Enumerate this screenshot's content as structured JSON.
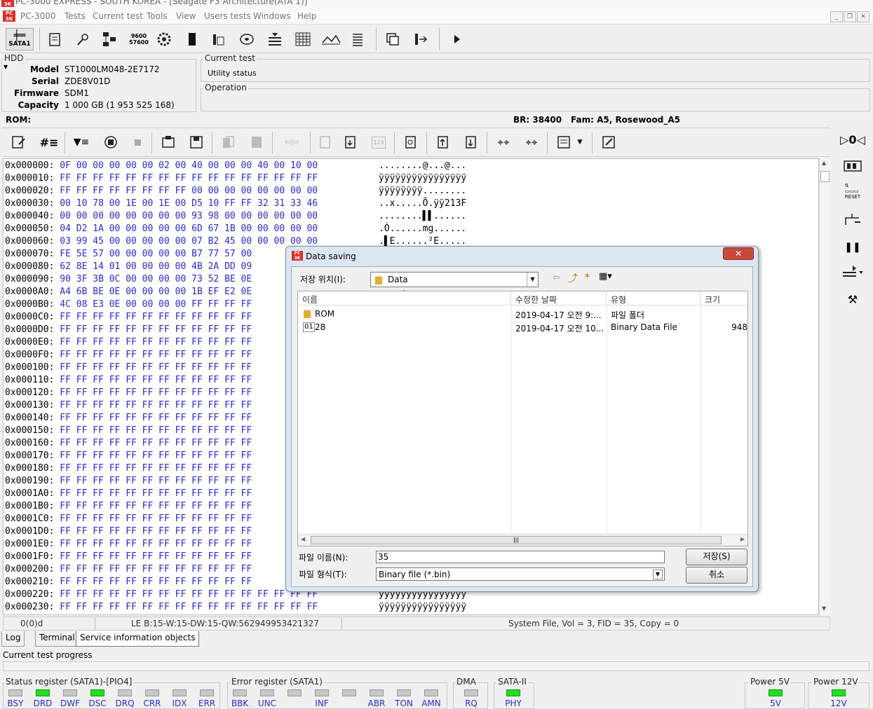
{
  "app": {
    "title": "PC-3000 EXPRESS - SOUTH KOREA - [Seagate F3 Architecture(ATA 1)]",
    "menu": [
      "PC-3000",
      "Tests",
      "Current test",
      "Tools",
      "View",
      "Users tests",
      "Windows",
      "Help"
    ],
    "sata_label": "SATA1"
  },
  "hdd": {
    "group_label": "HDD",
    "fields": [
      {
        "k": "Model",
        "v": "ST1000LM048-2E7172"
      },
      {
        "k": "Serial",
        "v": "ZDE8V01D"
      },
      {
        "k": "Firmware",
        "v": "SDM1"
      },
      {
        "k": "Capacity",
        "v": "1 000 GB (1 953 525 168)"
      }
    ]
  },
  "current_test": {
    "label": "Current test",
    "value": "Utility status"
  },
  "operation": {
    "label": "Operation"
  },
  "rom_bar": {
    "rom": "ROM:",
    "br": "BR: 38400",
    "fam": "Fam: A5, Rosewood_A5"
  },
  "hex": {
    "rows": [
      {
        "off": "0x000000:",
        "bytes": "0F 00 00 00 00 00 02 00 40 00 00 00 40 00 10 00",
        "ascii": "........@...@..."
      },
      {
        "off": "0x000010:",
        "bytes": "FF FF FF FF FF FF FF FF FF FF FF FF FF FF FF FF",
        "ascii": "ÿÿÿÿÿÿÿÿÿÿÿÿÿÿÿÿ"
      },
      {
        "off": "0x000020:",
        "bytes": "FF FF FF FF FF FF FF FF 00 00 00 00 00 00 00 00",
        "ascii": "ÿÿÿÿÿÿÿÿ........"
      },
      {
        "off": "0x000030:",
        "bytes": "00 10 78 00 1E 00 1E 00 D5 10 FF FF 32 31 33 46",
        "ascii": "..x.....Õ.ÿÿ213F"
      },
      {
        "off": "0x000040:",
        "bytes": "00 00 00 00 00 00 00 00 93 98 00 00 00 00 00 00",
        "ascii": "........▌▌......"
      },
      {
        "off": "0x000050:",
        "bytes": "04 D2 1A 00 00 00 00 00 6D 67 1B 00 00 00 00 00",
        "ascii": ".Ò......mg......"
      },
      {
        "off": "0x000060:",
        "bytes": "03 99 45 00 00 00 00 00 07 B2 45 00 00 00 00 00",
        "ascii": ".▌E......²E....."
      },
      {
        "off": "0x000070:",
        "bytes": "FE 5E 57 00 00 00 00 00 B7 77 57 00",
        "ascii": ""
      },
      {
        "off": "0x000080:",
        "bytes": "62 8E 14 01 00 00 00 00 4B 2A DD 09",
        "ascii": ""
      },
      {
        "off": "0x000090:",
        "bytes": "90 3F 3B 0C 00 00 00 00 73 52 BE 0E",
        "ascii": ""
      },
      {
        "off": "0x0000A0:",
        "bytes": "A4 6B BE 0E 00 00 00 00 1B EF E2 0E",
        "ascii": ""
      },
      {
        "off": "0x0000B0:",
        "bytes": "4C 08 E3 0E 00 00 00 00 FF FF FF FF",
        "ascii": ""
      },
      {
        "off": "0x0000C0:",
        "bytes": "FF FF FF FF FF FF FF FF FF FF FF FF",
        "ascii": ""
      },
      {
        "off": "0x0000D0:",
        "bytes": "FF FF FF FF FF FF FF FF FF FF FF FF",
        "ascii": ""
      },
      {
        "off": "0x0000E0:",
        "bytes": "FF FF FF FF FF FF FF FF FF FF FF FF",
        "ascii": ""
      },
      {
        "off": "0x0000F0:",
        "bytes": "FF FF FF FF FF FF FF FF FF FF FF FF",
        "ascii": ""
      },
      {
        "off": "0x000100:",
        "bytes": "FF FF FF FF FF FF FF FF FF FF FF FF",
        "ascii": ""
      },
      {
        "off": "0x000110:",
        "bytes": "FF FF FF FF FF FF FF FF FF FF FF FF",
        "ascii": ""
      },
      {
        "off": "0x000120:",
        "bytes": "FF FF FF FF FF FF FF FF FF FF FF FF",
        "ascii": ""
      },
      {
        "off": "0x000130:",
        "bytes": "FF FF FF FF FF FF FF FF FF FF FF FF",
        "ascii": ""
      },
      {
        "off": "0x000140:",
        "bytes": "FF FF FF FF FF FF FF FF FF FF FF FF",
        "ascii": ""
      },
      {
        "off": "0x000150:",
        "bytes": "FF FF FF FF FF FF FF FF FF FF FF FF",
        "ascii": ""
      },
      {
        "off": "0x000160:",
        "bytes": "FF FF FF FF FF FF FF FF FF FF FF FF",
        "ascii": ""
      },
      {
        "off": "0x000170:",
        "bytes": "FF FF FF FF FF FF FF FF FF FF FF FF",
        "ascii": ""
      },
      {
        "off": "0x000180:",
        "bytes": "FF FF FF FF FF FF FF FF FF FF FF FF",
        "ascii": ""
      },
      {
        "off": "0x000190:",
        "bytes": "FF FF FF FF FF FF FF FF FF FF FF FF",
        "ascii": ""
      },
      {
        "off": "0x0001A0:",
        "bytes": "FF FF FF FF FF FF FF FF FF FF FF FF",
        "ascii": ""
      },
      {
        "off": "0x0001B0:",
        "bytes": "FF FF FF FF FF FF FF FF FF FF FF FF",
        "ascii": ""
      },
      {
        "off": "0x0001C0:",
        "bytes": "FF FF FF FF FF FF FF FF FF FF FF FF",
        "ascii": ""
      },
      {
        "off": "0x0001D0:",
        "bytes": "FF FF FF FF FF FF FF FF FF FF FF FF",
        "ascii": ""
      },
      {
        "off": "0x0001E0:",
        "bytes": "FF FF FF FF FF FF FF FF FF FF FF FF",
        "ascii": ""
      },
      {
        "off": "0x0001F0:",
        "bytes": "FF FF FF FF FF FF FF FF FF FF FF FF",
        "ascii": ""
      },
      {
        "off": "0x000200:",
        "bytes": "FF FF FF FF FF FF FF FF FF FF FF FF",
        "ascii": ""
      },
      {
        "off": "0x000210:",
        "bytes": "FF FF FF FF FF FF FF FF FF FF FF FF",
        "ascii": ""
      },
      {
        "off": "0x000220:",
        "bytes": "FF FF FF FF FF FF FF FF FF FF FF FF FF FF FF FF",
        "ascii": "ÿÿÿÿÿÿÿÿÿÿÿÿÿÿÿÿ"
      },
      {
        "off": "0x000230:",
        "bytes": "FF FF FF FF FF FF FF FF FF FF FF FF FF FF FF FF",
        "ascii": "ÿÿÿÿÿÿÿÿÿÿÿÿÿÿÿÿ"
      }
    ]
  },
  "status_row": {
    "pos": "0(0)d",
    "le": "LE B:15-W:15-DW:15-QW:562949953421327",
    "sysfile": "System File, Vol = 3, FID = 35, Copy = 0"
  },
  "tabs": [
    "Log",
    "Terminal",
    "Service information objects"
  ],
  "progress_label": "Current test progress",
  "status_register": {
    "label": "Status register (SATA1)-[PIO4]",
    "leds": [
      {
        "name": "BSY",
        "on": false
      },
      {
        "name": "DRD",
        "on": true
      },
      {
        "name": "DWF",
        "on": false
      },
      {
        "name": "DSC",
        "on": true
      },
      {
        "name": "DRQ",
        "on": false
      },
      {
        "name": "CRR",
        "on": false
      },
      {
        "name": "IDX",
        "on": false
      },
      {
        "name": "ERR",
        "on": false
      }
    ]
  },
  "error_register": {
    "label": "Error register (SATA1)",
    "leds": [
      {
        "name": "BBK",
        "on": false
      },
      {
        "name": "UNC",
        "on": false
      },
      {
        "name": "",
        "on": false
      },
      {
        "name": "INF",
        "on": false
      },
      {
        "name": "",
        "on": false
      },
      {
        "name": "ABR",
        "on": false
      },
      {
        "name": "TON",
        "on": false
      },
      {
        "name": "AMN",
        "on": false
      }
    ]
  },
  "dma": {
    "label": "DMA",
    "led": "RQ"
  },
  "sata2": {
    "label": "SATA-II",
    "led": "PHY"
  },
  "power5": {
    "label": "Power 5V",
    "led": "5V"
  },
  "power12": {
    "label": "Power 12V",
    "led": "12V"
  },
  "dialog": {
    "title": "Data saving",
    "save_in_label": "저장 위치(I):",
    "save_in_value": "Data",
    "columns": [
      "이름",
      "수정한 날짜",
      "유형",
      "크기"
    ],
    "files": [
      {
        "name": "ROM",
        "date": "2019-04-17 오전 9:...",
        "type": "파일 폴더",
        "size": "",
        "icon": "folder-icon"
      },
      {
        "name": "28",
        "date": "2019-04-17 오전 10...",
        "type": "Binary Data File",
        "size": "948",
        "icon": "binary-file-icon"
      }
    ],
    "filename_label": "파일 이름(N):",
    "filename_value": "35",
    "filetype_label": "파일 형식(T):",
    "filetype_value": "Binary file (*.bin)",
    "save_button": "저장(S)",
    "cancel_button": "취소"
  }
}
